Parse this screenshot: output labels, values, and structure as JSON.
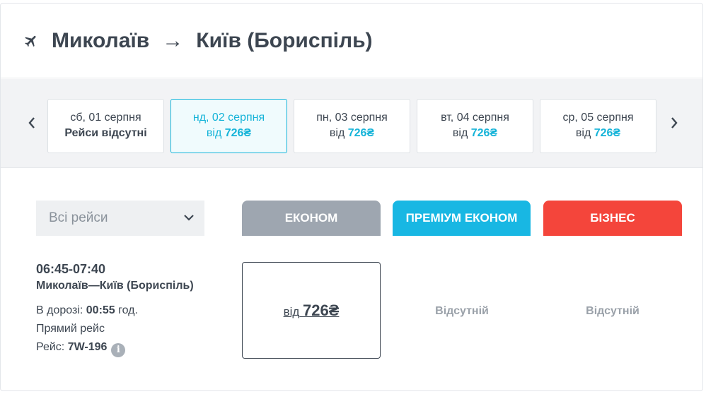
{
  "header": {
    "origin": "Миколаїв",
    "arrow": "→",
    "destination": "Київ (Бориспіль)"
  },
  "dates": [
    {
      "day": "сб, 01 серпня",
      "unavailable": "Рейси відсутні"
    },
    {
      "day": "нд, 02 серпня",
      "from": "від",
      "price": "726₴",
      "selected": true
    },
    {
      "day": "пн, 03 серпня",
      "from": "від",
      "price": "726₴"
    },
    {
      "day": "вт, 04 серпня",
      "from": "від",
      "price": "726₴"
    },
    {
      "day": "ср, 05 серпня",
      "from": "від",
      "price": "726₴"
    }
  ],
  "filter": {
    "label": "Всі рейси"
  },
  "classes": {
    "economy": "ЕКОНОМ",
    "premium": "ПРЕМІУМ ЕКОНОМ",
    "business": "БІЗНЕС"
  },
  "flight": {
    "time": "06:45-07:40",
    "route": "Миколаїв—Київ (Бориспіль)",
    "duration_label": "В дорозі:",
    "duration_value": "00:55",
    "duration_unit": "год.",
    "type": "Прямий рейс",
    "flight_label": "Рейс:",
    "flight_number": "7W-196",
    "info_glyph": "i"
  },
  "fares": {
    "economy_from": "від",
    "economy_price": "726₴",
    "premium": "Відсутній",
    "business": "Відсутній"
  },
  "colors": {
    "accent": "#14b3d8",
    "economy": "#9ea6b0",
    "premium": "#18b7e3",
    "business": "#f4453b",
    "text": "#3d4651"
  }
}
